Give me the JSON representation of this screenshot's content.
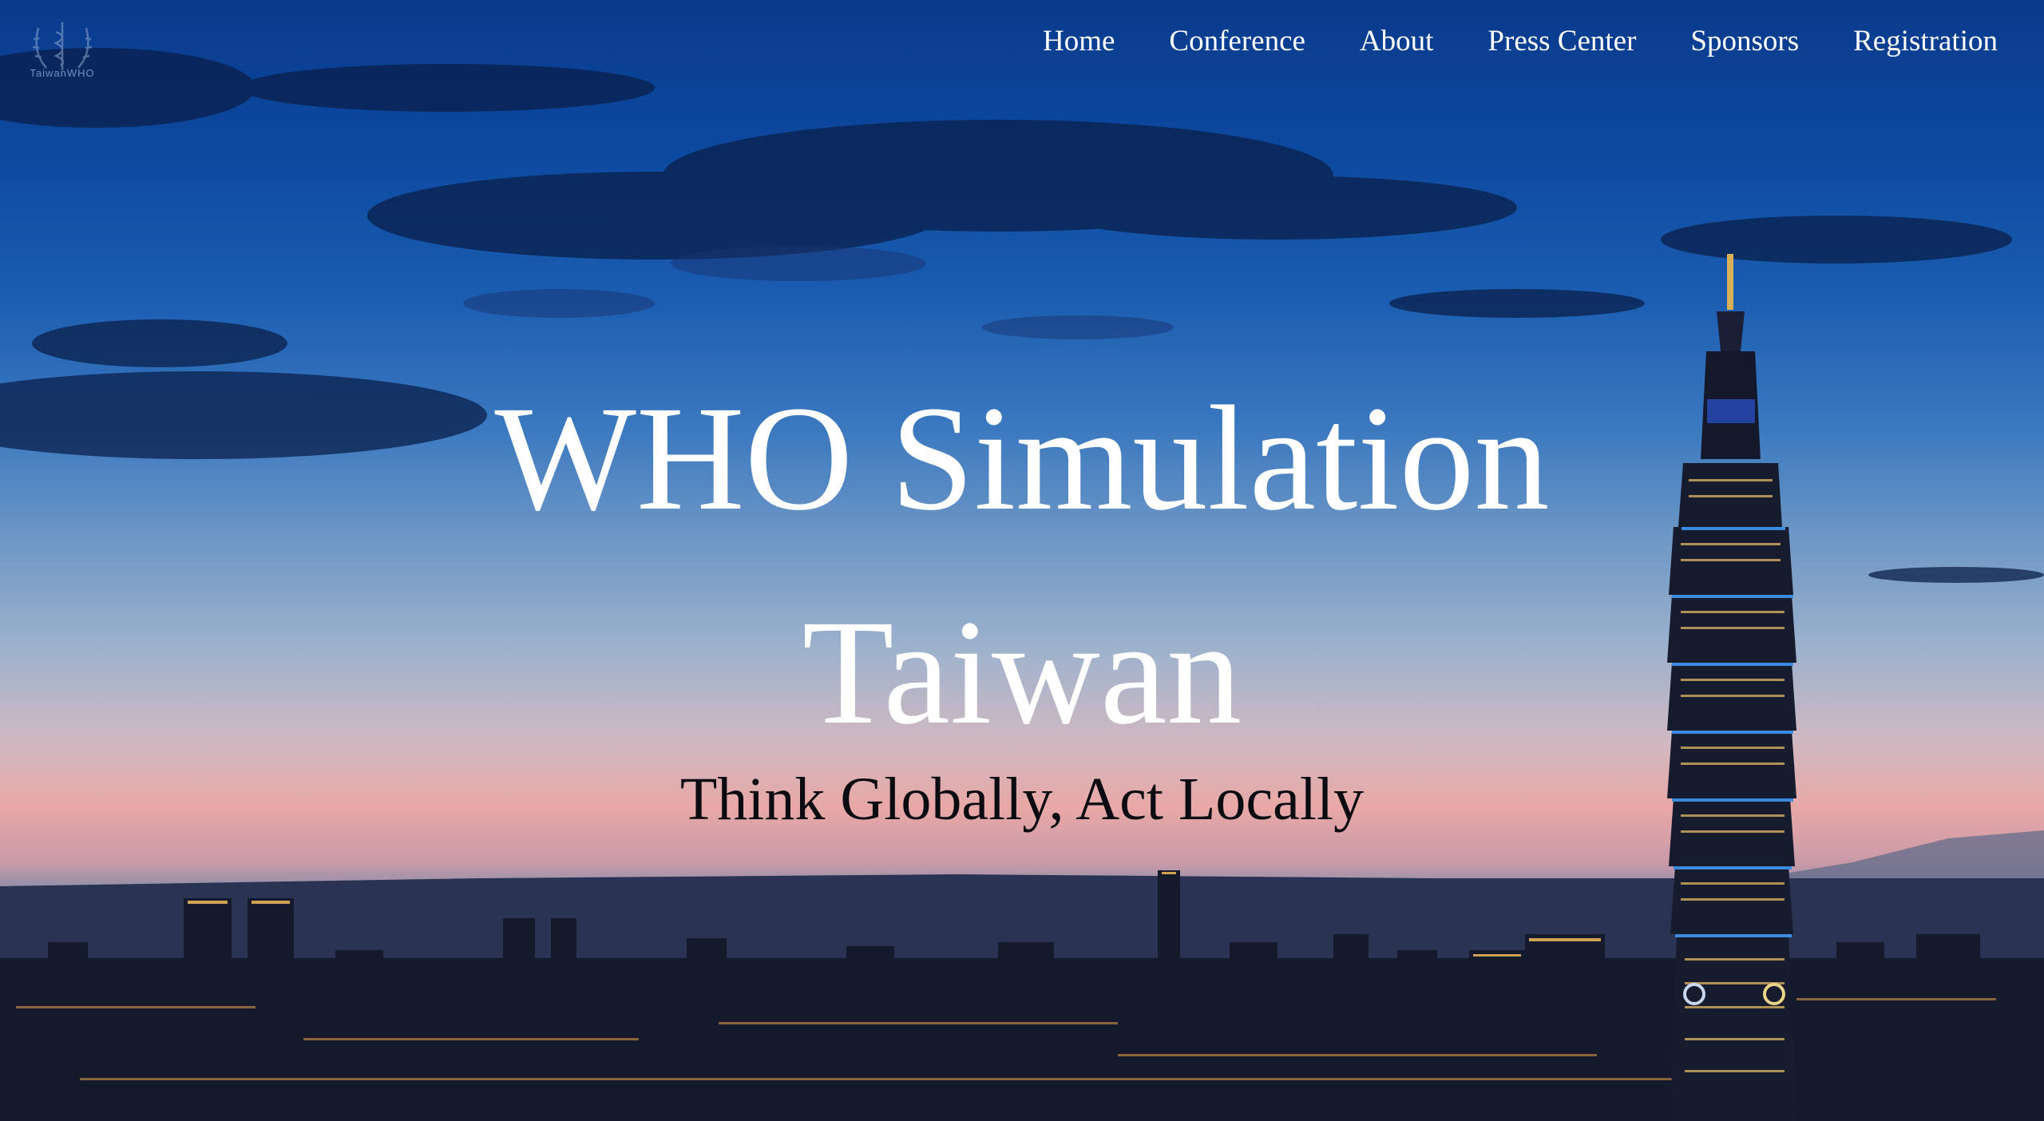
{
  "logo": {
    "icon": "caduceus-laurel-icon",
    "text": "TaiwanWHO"
  },
  "nav": {
    "items": [
      {
        "label": "Home"
      },
      {
        "label": "Conference"
      },
      {
        "label": "About"
      },
      {
        "label": "Press Center"
      },
      {
        "label": "Sponsors"
      },
      {
        "label": "Registration"
      }
    ]
  },
  "hero": {
    "title_line1": "WHO Simulation",
    "title_line2": "Taiwan",
    "subtitle": "Think Globally, Act Locally",
    "background": "taipei-skyline-dusk-image"
  },
  "colors": {
    "nav_text": "#ffffff",
    "title_text": "#ffffff",
    "subtitle_text": "#0b0b12",
    "sky_top": "#0a3a8c",
    "sky_horizon": "#e8a8a6"
  }
}
